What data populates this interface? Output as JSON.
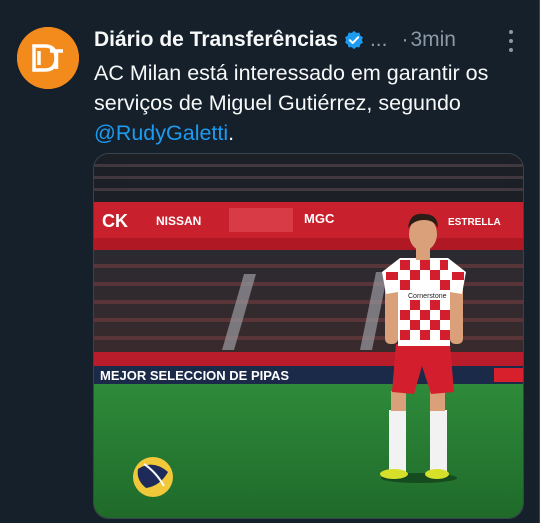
{
  "tweet": {
    "author_name": "Diário de Transferências",
    "avatar_initials": "DT",
    "verified_icon": "verified-badge-icon",
    "ellipsis": "...",
    "separator": "·",
    "time": "3min",
    "text_main": "AC Milan está interessado em garantir os serviços de Miguel Gutiérrez, segundo ",
    "mention": "@RudyGaletti",
    "text_end": ".",
    "more_icon": "more-options-icon"
  },
  "media": {
    "board_top": [
      "NISSAN",
      "MGC",
      "ESTRELLA"
    ],
    "board_bottom": "MEJOR SELECCION DE PIPAS",
    "board_bottom_highlight": "SELECCION",
    "jersey_text": "Cornerstone"
  },
  "colors": {
    "background": "#15202b",
    "accent_blue": "#1d9bf0",
    "avatar_orange": "#f28a1c",
    "muted": "#8b98a5"
  }
}
